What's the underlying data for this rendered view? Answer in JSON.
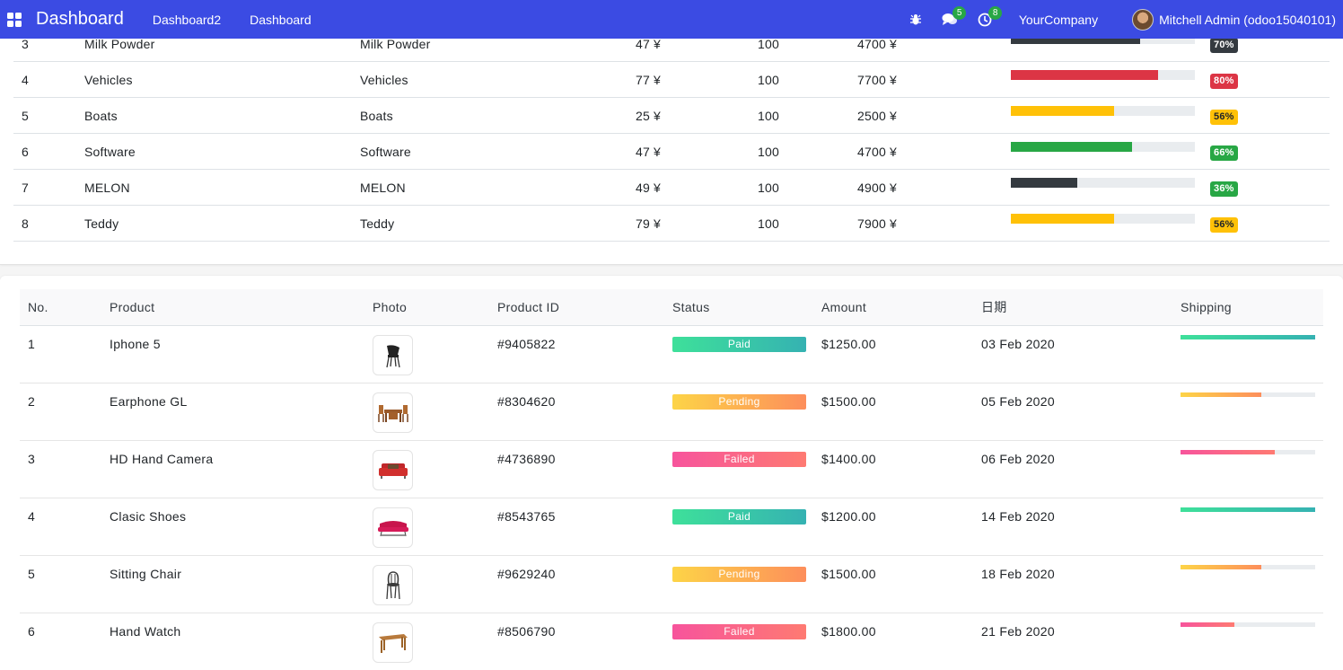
{
  "navbar": {
    "brand": "Dashboard",
    "menu": [
      "Dashboard2",
      "Dashboard"
    ],
    "messages_count": "5",
    "activities_count": "8",
    "company": "YourCompany",
    "user": "Mitchell Admin (odoo15040101)"
  },
  "top_table": {
    "rows": [
      {
        "no": "3",
        "name": "Milk Powder",
        "category": "Milk Powder",
        "price": "47 ¥",
        "qty": "100",
        "total": "4700 ¥",
        "progress": 0.7,
        "pct": "70%",
        "bar_color": "#343a40",
        "badge_bg": "#343a40",
        "badge_fg": "#ffffff"
      },
      {
        "no": "4",
        "name": "Vehicles",
        "category": "Vehicles",
        "price": "77 ¥",
        "qty": "100",
        "total": "7700 ¥",
        "progress": 0.8,
        "pct": "80%",
        "bar_color": "#dc3545",
        "badge_bg": "#dc3545",
        "badge_fg": "#ffffff"
      },
      {
        "no": "5",
        "name": "Boats",
        "category": "Boats",
        "price": "25 ¥",
        "qty": "100",
        "total": "2500 ¥",
        "progress": 0.56,
        "pct": "56%",
        "bar_color": "#ffc107",
        "badge_bg": "#ffc107",
        "badge_fg": "#212529"
      },
      {
        "no": "6",
        "name": "Software",
        "category": "Software",
        "price": "47 ¥",
        "qty": "100",
        "total": "4700 ¥",
        "progress": 0.66,
        "pct": "66%",
        "bar_color": "#28a745",
        "badge_bg": "#28a745",
        "badge_fg": "#ffffff"
      },
      {
        "no": "7",
        "name": "MELON",
        "category": "MELON",
        "price": "49 ¥",
        "qty": "100",
        "total": "4900 ¥",
        "progress": 0.36,
        "pct": "36%",
        "bar_color": "#343a40",
        "badge_bg": "#28a745",
        "badge_fg": "#ffffff"
      },
      {
        "no": "8",
        "name": "Teddy",
        "category": "Teddy",
        "price": "79 ¥",
        "qty": "100",
        "total": "7900 ¥",
        "progress": 0.56,
        "pct": "56%",
        "bar_color": "#ffc107",
        "badge_bg": "#ffc107",
        "badge_fg": "#212529"
      }
    ]
  },
  "orders_table": {
    "headers": [
      "No.",
      "Product",
      "Photo",
      "Product ID",
      "Status",
      "Amount",
      "日期",
      "Shipping"
    ],
    "rows": [
      {
        "no": "1",
        "product": "Iphone 5",
        "photo_icon": "black-chair-icon",
        "product_id": "#9405822",
        "status": "Paid",
        "amount": "$1250.00",
        "date": "03 Feb 2020",
        "shipping": 1.0,
        "status_type": "paid"
      },
      {
        "no": "2",
        "product": "Earphone GL",
        "photo_icon": "dining-set-icon",
        "product_id": "#8304620",
        "status": "Pending",
        "amount": "$1500.00",
        "date": "05 Feb 2020",
        "shipping": 0.6,
        "status_type": "pending"
      },
      {
        "no": "3",
        "product": "HD Hand Camera",
        "photo_icon": "red-sofa-icon",
        "product_id": "#4736890",
        "status": "Failed",
        "amount": "$1400.00",
        "date": "06 Feb 2020",
        "shipping": 0.7,
        "status_type": "failed"
      },
      {
        "no": "4",
        "product": "Clasic Shoes",
        "photo_icon": "pink-sofa-icon",
        "product_id": "#8543765",
        "status": "Paid",
        "amount": "$1200.00",
        "date": "14 Feb 2020",
        "shipping": 1.0,
        "status_type": "paid"
      },
      {
        "no": "5",
        "product": "Sitting Chair",
        "photo_icon": "bentwood-chair-icon",
        "product_id": "#9629240",
        "status": "Pending",
        "amount": "$1500.00",
        "date": "18 Feb 2020",
        "shipping": 0.6,
        "status_type": "pending"
      },
      {
        "no": "6",
        "product": "Hand Watch",
        "photo_icon": "wooden-table-icon",
        "product_id": "#8506790",
        "status": "Failed",
        "amount": "$1800.00",
        "date": "21 Feb 2020",
        "shipping": 0.4,
        "status_type": "failed"
      }
    ]
  },
  "colors": {
    "navbar": "#3b4be3",
    "paid": "linear-gradient(90deg,#3ee09a,#35b2b2)",
    "pending": "linear-gradient(90deg,#fdd447,#fd8e5b)",
    "failed": "linear-gradient(90deg,#f7549c,#fe7a72)"
  }
}
